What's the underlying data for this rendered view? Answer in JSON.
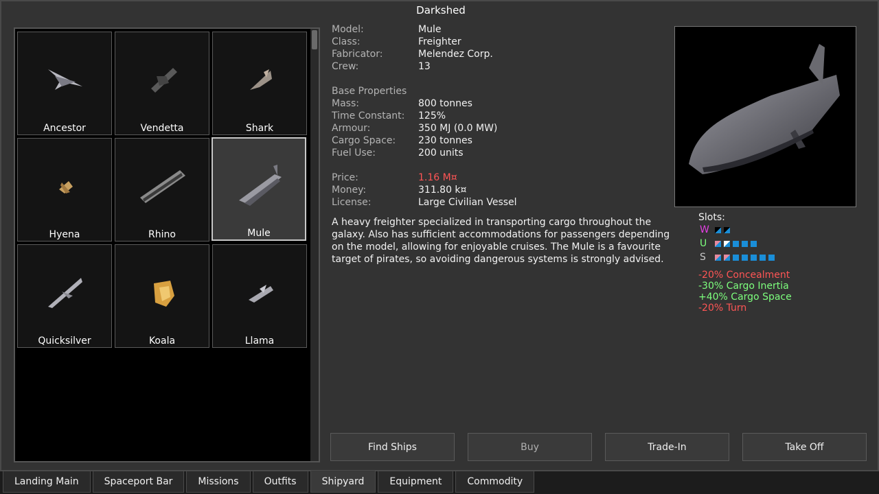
{
  "window": {
    "title": "Darkshed"
  },
  "ships": [
    {
      "name": "Ancestor"
    },
    {
      "name": "Vendetta"
    },
    {
      "name": "Shark"
    },
    {
      "name": "Hyena"
    },
    {
      "name": "Rhino"
    },
    {
      "name": "Mule"
    },
    {
      "name": "Quicksilver"
    },
    {
      "name": "Koala"
    },
    {
      "name": "Llama"
    }
  ],
  "selected_ship": "Mule",
  "details": {
    "model_label": "Model:",
    "model": "Mule",
    "class_label": "Class:",
    "class": "Freighter",
    "fabricator_label": "Fabricator:",
    "fabricator": "Melendez Corp.",
    "crew_label": "Crew:",
    "crew": "13",
    "base_heading": "Base Properties",
    "mass_label": "Mass:",
    "mass": "800 tonnes",
    "time_label": "Time Constant:",
    "time": "125%",
    "armour_label": "Armour:",
    "armour": "350 MJ (0.0 MW)",
    "cargo_label": "Cargo Space:",
    "cargo": "230 tonnes",
    "fuel_label": "Fuel Use:",
    "fuel": "200 units",
    "price_label": "Price:",
    "price": "1.16 M¤",
    "money_label": "Money:",
    "money": "311.80 k¤",
    "license_label": "License:",
    "license": "Large Civilian Vessel"
  },
  "description": "A heavy freighter specialized in transporting cargo throughout the galaxy. Also has sufficient accommodations for passengers depending on the model, allowing for enjoyable cruises. The Mule is a favourite target of pirates, so avoiding dangerous systems is strongly advised.",
  "slots": {
    "heading": "Slots:",
    "weapon_key": "W",
    "utility_key": "U",
    "structure_key": "S",
    "weapon_color": "#e040e0",
    "utility_color": "#7dff7d",
    "structure_color": "#c8c8c8"
  },
  "modifiers": [
    {
      "text": "-20% Concealment",
      "color": "red"
    },
    {
      "text": "-30% Cargo Inertia",
      "color": "green"
    },
    {
      "text": "+40% Cargo Space",
      "color": "green"
    },
    {
      "text": "-20% Turn",
      "color": "red"
    }
  ],
  "buttons": {
    "find": "Find Ships",
    "buy": "Buy",
    "trade": "Trade-In",
    "takeoff": "Take Off"
  },
  "tabs": [
    "Landing Main",
    "Spaceport Bar",
    "Missions",
    "Outfits",
    "Shipyard",
    "Equipment",
    "Commodity"
  ],
  "active_tab": "Shipyard"
}
